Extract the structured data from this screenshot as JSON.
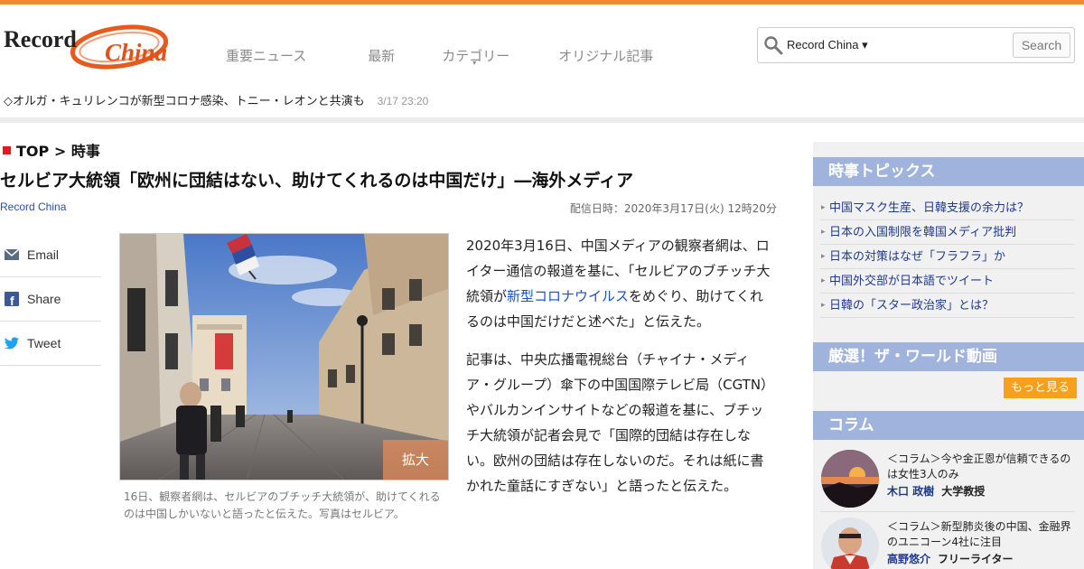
{
  "brand": {
    "logo_text_1": "Record",
    "logo_text_2": "China",
    "accent": "#f08a2e"
  },
  "nav": {
    "items": [
      {
        "label": "重要ニュース"
      },
      {
        "label": "最新"
      },
      {
        "label": "カテゴリー",
        "caret": "▾"
      },
      {
        "label": "オリジナル記事"
      }
    ]
  },
  "search": {
    "site_label": "Record China ▾",
    "button_label": "Search",
    "icon": "search-icon"
  },
  "ticker": {
    "text": "◇オルガ・キュリレンコが新型コロナ感染、トニー・レオンと共演も",
    "time": "3/17 23:20"
  },
  "breadcrumb": {
    "home": "TOP",
    "sep": ">",
    "section": "時事"
  },
  "article": {
    "title": "セルビア大統領「欧州に団結はない、助けてくれるのは中国だけ」―海外メディア",
    "source": "Record China",
    "date": "配信日時：2020年3月17日(火) 12時20分",
    "photo_zoom_label": "拡大",
    "caption": "16日、観察者網は、セルビアのブチッチ大統領が、助けてくれるのは中国しかいないと語ったと伝えた。写真はセルビア。",
    "p1_before": "2020年3月16日、中国メディアの観察者網は、ロイター通信の報道を基に、「セルビアのブチッチ大統領が",
    "p1_link": "新型コロナウイルス",
    "p1_after": "をめぐり、助けてくれるのは中国だけだと述べた」と伝えた。",
    "p2": "記事は、中央広播電視総台（チャイナ・メディア・グループ）傘下の中国国際テレビ局（CGTN）やバルカンインサイトなどの報道を基に、ブチッチ大統領が記者会見で「国際的団結は存在しない。欧州の団結は存在しないのだ。それは紙に書かれた童話にすぎない」と語ったと伝えた。"
  },
  "share": {
    "items": [
      {
        "label": "Email",
        "icon": "email-icon"
      },
      {
        "label": "Share",
        "icon": "facebook-icon"
      },
      {
        "label": "Tweet",
        "icon": "twitter-icon"
      }
    ]
  },
  "sidebar": {
    "topics_title": "時事トピックス",
    "topics": [
      "中国マスク生産、日韓支援の余力は？",
      "日本の入国制限を韓国メディア批判",
      "日本の対策はなぜ「フラフラ」か",
      "中国外交部が日本語でツイート",
      "日韓の「スター政治家」とは？"
    ],
    "video_title": "厳選！ザ・ワールド動画",
    "more_label": "もっと見る",
    "column_title": "コラム",
    "columns": [
      {
        "title": "＜コラム＞今や金正恩が信頼できるのは女性3人のみ",
        "author": "木口 政樹",
        "role": "大学教授"
      },
      {
        "title": "＜コラム＞新型肺炎後の中国、金融界のユニコーン4社に注目",
        "author": "高野悠介",
        "role": "フリーライター"
      }
    ]
  }
}
